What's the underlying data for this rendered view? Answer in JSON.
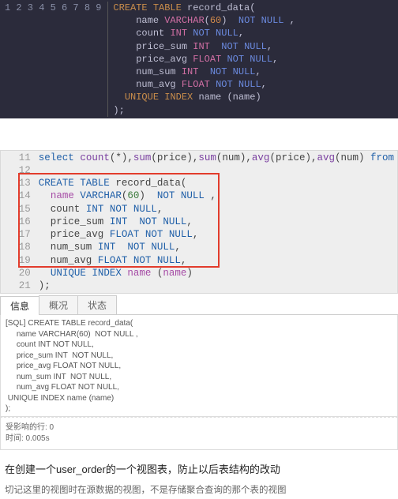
{
  "dark_code": {
    "gutter": [
      "1",
      "2",
      "3",
      "4",
      "5",
      "6",
      "7",
      "8",
      "9"
    ],
    "lines": [
      [
        {
          "c": "kw-orange",
          "t": "CREATE TABLE"
        },
        {
          "c": "plain",
          "t": " record_data("
        }
      ],
      [
        {
          "c": "plain",
          "t": "    name "
        },
        {
          "c": "kw-pink",
          "t": "VARCHAR"
        },
        {
          "c": "plain",
          "t": "("
        },
        {
          "c": "num-orange",
          "t": "60"
        },
        {
          "c": "plain",
          "t": ")  "
        },
        {
          "c": "kw-blue",
          "t": "NOT NULL"
        },
        {
          "c": "plain",
          "t": " ,"
        }
      ],
      [
        {
          "c": "plain",
          "t": "    count "
        },
        {
          "c": "kw-pink",
          "t": "INT"
        },
        {
          "c": "plain",
          "t": " "
        },
        {
          "c": "kw-blue",
          "t": "NOT NULL"
        },
        {
          "c": "plain",
          "t": ","
        }
      ],
      [
        {
          "c": "plain",
          "t": "    price_sum "
        },
        {
          "c": "kw-pink",
          "t": "INT"
        },
        {
          "c": "plain",
          "t": "  "
        },
        {
          "c": "kw-blue",
          "t": "NOT NULL"
        },
        {
          "c": "plain",
          "t": ","
        }
      ],
      [
        {
          "c": "plain",
          "t": "    price_avg "
        },
        {
          "c": "kw-pink",
          "t": "FLOAT"
        },
        {
          "c": "plain",
          "t": " "
        },
        {
          "c": "kw-blue",
          "t": "NOT NULL"
        },
        {
          "c": "plain",
          "t": ","
        }
      ],
      [
        {
          "c": "plain",
          "t": "    num_sum "
        },
        {
          "c": "kw-pink",
          "t": "INT"
        },
        {
          "c": "plain",
          "t": "  "
        },
        {
          "c": "kw-blue",
          "t": "NOT NULL"
        },
        {
          "c": "plain",
          "t": ","
        }
      ],
      [
        {
          "c": "plain",
          "t": "    num_avg "
        },
        {
          "c": "kw-pink",
          "t": "FLOAT"
        },
        {
          "c": "plain",
          "t": " "
        },
        {
          "c": "kw-blue",
          "t": "NOT NULL"
        },
        {
          "c": "plain",
          "t": ","
        }
      ],
      [
        {
          "c": "plain",
          "t": "  "
        },
        {
          "c": "kw-orange",
          "t": "UNIQUE INDEX"
        },
        {
          "c": "plain",
          "t": " name (name)"
        }
      ],
      [
        {
          "c": "plain",
          "t": ");"
        }
      ]
    ]
  },
  "light_code": {
    "gutter": [
      "11",
      "12",
      "13",
      "14",
      "15",
      "16",
      "17",
      "18",
      "19",
      "20",
      "21"
    ],
    "lines": [
      [
        {
          "c": "l-kw",
          "t": "select"
        },
        {
          "c": "",
          "t": " "
        },
        {
          "c": "l-fn",
          "t": "count"
        },
        {
          "c": "",
          "t": "(*),"
        },
        {
          "c": "l-fn",
          "t": "sum"
        },
        {
          "c": "",
          "t": "(price),"
        },
        {
          "c": "l-fn",
          "t": "sum"
        },
        {
          "c": "",
          "t": "(num),"
        },
        {
          "c": "l-fn",
          "t": "avg"
        },
        {
          "c": "",
          "t": "(price),"
        },
        {
          "c": "l-fn",
          "t": "avg"
        },
        {
          "c": "",
          "t": "(num) "
        },
        {
          "c": "l-kw",
          "t": "from"
        }
      ],
      [
        {
          "c": "",
          "t": ""
        }
      ],
      [
        {
          "c": "l-kw",
          "t": "CREATE TABLE"
        },
        {
          "c": "",
          "t": " record_data("
        }
      ],
      [
        {
          "c": "",
          "t": "  "
        },
        {
          "c": "l-id",
          "t": "name"
        },
        {
          "c": "",
          "t": " "
        },
        {
          "c": "l-kw",
          "t": "VARCHAR"
        },
        {
          "c": "",
          "t": "("
        },
        {
          "c": "l-num",
          "t": "60"
        },
        {
          "c": "",
          "t": ")  "
        },
        {
          "c": "l-kw",
          "t": "NOT NULL"
        },
        {
          "c": "",
          "t": " ,"
        }
      ],
      [
        {
          "c": "",
          "t": "  count "
        },
        {
          "c": "l-kw",
          "t": "INT NOT NULL"
        },
        {
          "c": "",
          "t": ","
        }
      ],
      [
        {
          "c": "",
          "t": "  price_sum "
        },
        {
          "c": "l-kw",
          "t": "INT"
        },
        {
          "c": "",
          "t": "  "
        },
        {
          "c": "l-kw",
          "t": "NOT NULL"
        },
        {
          "c": "",
          "t": ","
        }
      ],
      [
        {
          "c": "",
          "t": "  price_avg "
        },
        {
          "c": "l-kw",
          "t": "FLOAT NOT NULL"
        },
        {
          "c": "",
          "t": ","
        }
      ],
      [
        {
          "c": "",
          "t": "  num_sum "
        },
        {
          "c": "l-kw",
          "t": "INT"
        },
        {
          "c": "",
          "t": "  "
        },
        {
          "c": "l-kw",
          "t": "NOT NULL"
        },
        {
          "c": "",
          "t": ","
        }
      ],
      [
        {
          "c": "",
          "t": "  num_avg "
        },
        {
          "c": "l-kw",
          "t": "FLOAT NOT NULL"
        },
        {
          "c": "",
          "t": ","
        }
      ],
      [
        {
          "c": "",
          "t": "  "
        },
        {
          "c": "l-kw",
          "t": "UNIQUE INDEX"
        },
        {
          "c": "",
          "t": " "
        },
        {
          "c": "l-id",
          "t": "name"
        },
        {
          "c": "",
          "t": " ("
        },
        {
          "c": "l-id",
          "t": "name"
        },
        {
          "c": "",
          "t": ")"
        }
      ],
      [
        {
          "c": "",
          "t": ");"
        }
      ]
    ]
  },
  "tabs": {
    "info": "信息",
    "summary": "概况",
    "status": "状态"
  },
  "output_sql": "[SQL] CREATE TABLE record_data(\n     name VARCHAR(60)  NOT NULL ,\n     count INT NOT NULL,\n     price_sum INT  NOT NULL,\n     price_avg FLOAT NOT NULL,\n     num_sum INT  NOT NULL,\n     num_avg FLOAT NOT NULL,\n UNIQUE INDEX name (name)\n);",
  "meta": {
    "rows": "受影响的行: 0",
    "time": "时间: 0.005s"
  },
  "article": {
    "heading": "在创建一个user_order的一个视图表，防止以后表结构的改动",
    "sub": "切记这里的视图时在源数据的视图，不是存储聚合查询的那个表的视图"
  }
}
